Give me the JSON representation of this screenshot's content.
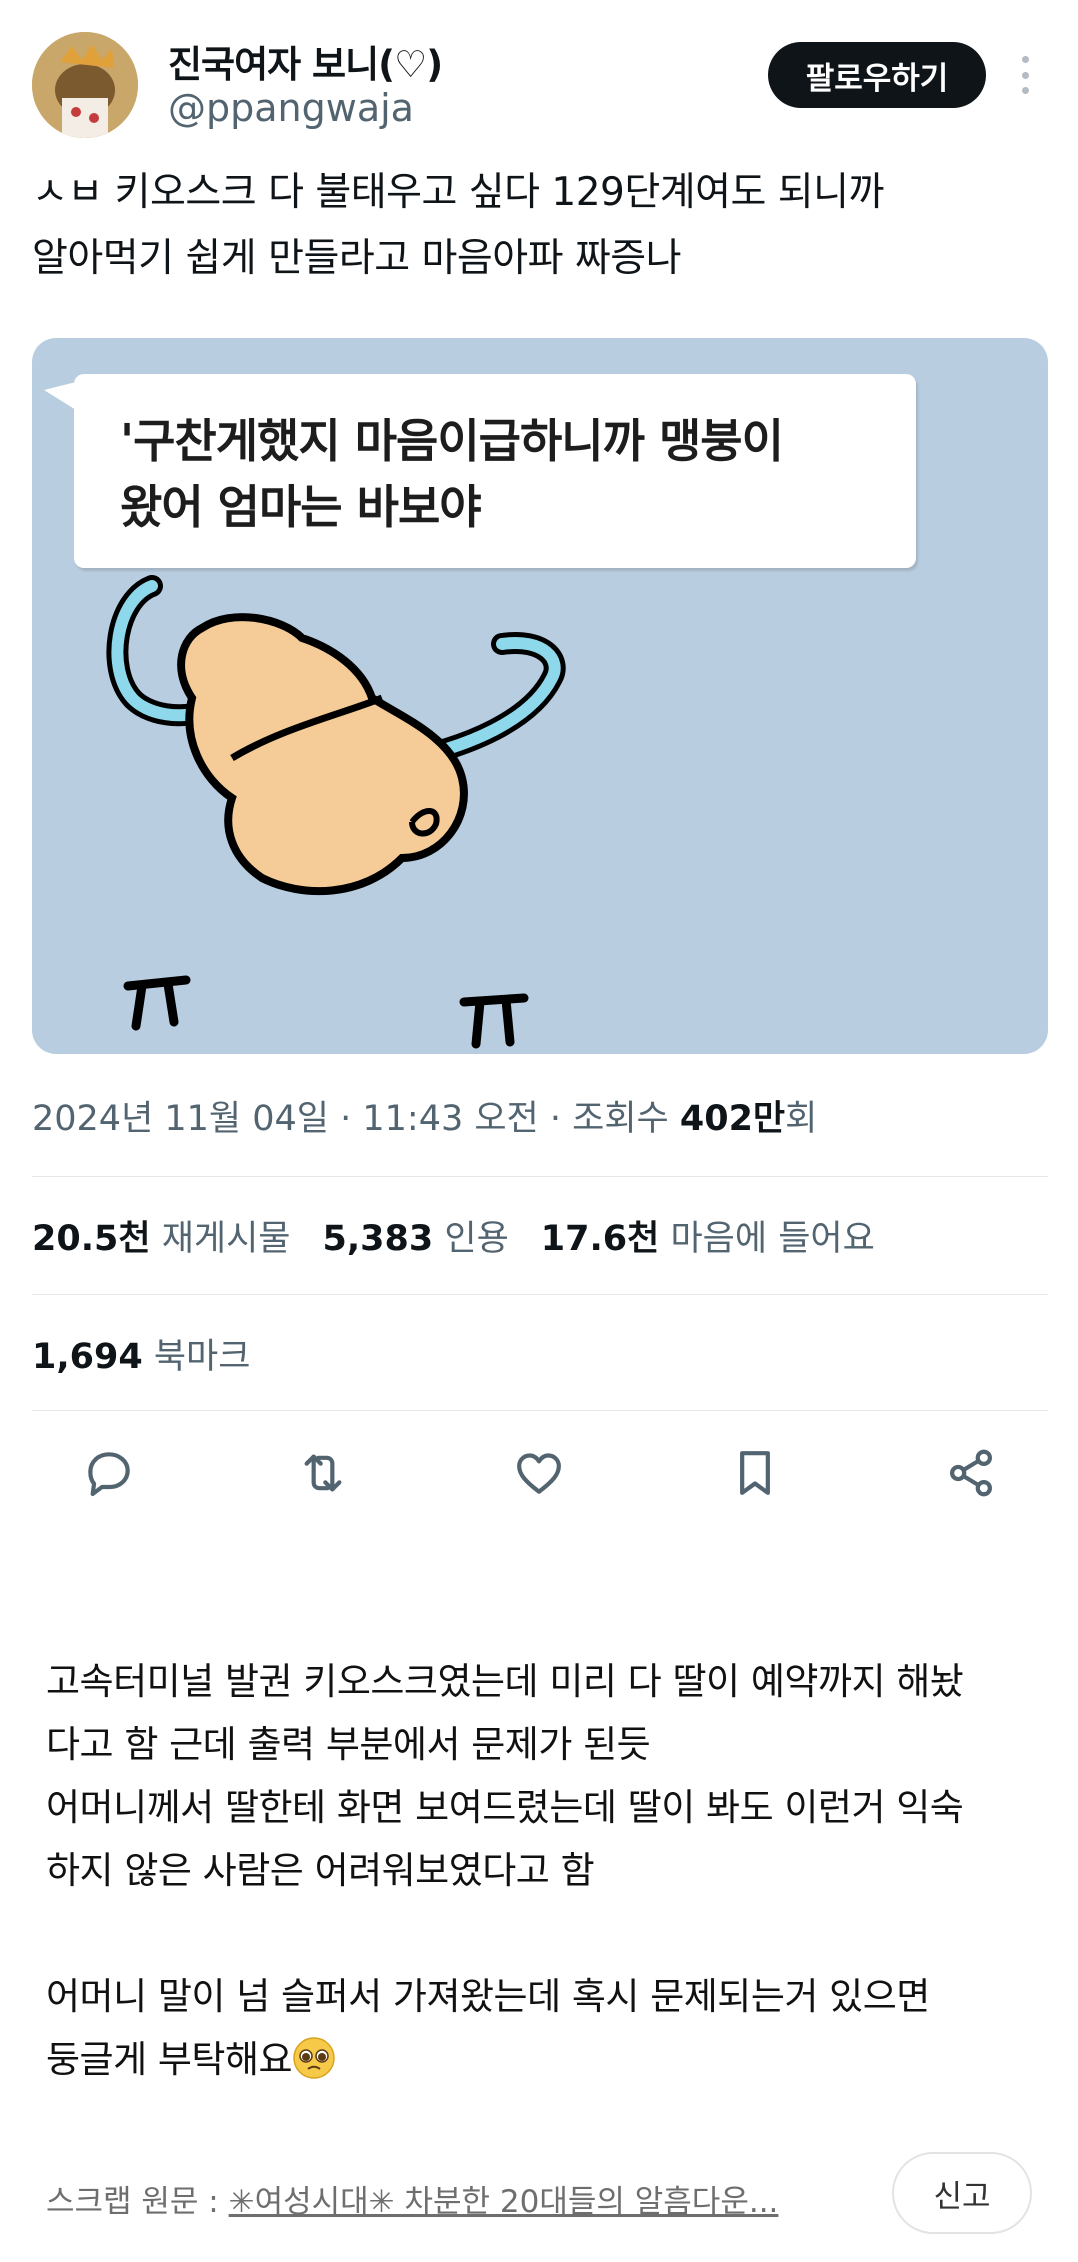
{
  "author": {
    "display_name": "진국여자 보니(♡)",
    "handle": "@ppangwaja",
    "follow_label": "팔로우하기"
  },
  "tweet": {
    "text": "ㅅㅂ 키오스크 다 불태우고 싶다 129단계여도 되니까\n알아먹기 쉽게 만들라고 마음아파 짜증나",
    "image_caption": "'구찬게했지 마음이급하니까 맹붕이\n왔어  엄마는 바보야"
  },
  "meta": {
    "date_time": "2024년 11월 04일 · 11:43 오전 · 조회수 ",
    "views_number": "402만",
    "views_suffix": "회"
  },
  "stats": {
    "retweets_num": "20.5천",
    "retweets_label": "재게시물",
    "quotes_num": "5,383",
    "quotes_label": "인용",
    "likes_num": "17.6천",
    "likes_label": "마음에 들어요",
    "bookmarks_num": "1,694",
    "bookmarks_label": "북마크"
  },
  "actions": {
    "icons": [
      "reply-icon",
      "retweet-icon",
      "like-icon",
      "bookmark-icon",
      "share-icon"
    ]
  },
  "post": {
    "body": "고속터미널 발권 키오스크였는데 미리 다 딸이 예약까지 해놨\n다고 함 근데 출력 부분에서 문제가 된듯\n어머니께서 딸한테 화면 보여드렸는데 딸이 봐도 이런거 익숙\n하지 않은 사람은 어려워보였다고 함\n\n어머니 말이 넘 슬퍼서 가져왔는데 혹시 문제되는거 있으면\n둥글게 부탁해요",
    "source_prefix": "스크랩 원문 : ",
    "source_link": "✳여성시대✳ 차분한 20대들의 알흠다운...",
    "report_label": "신고"
  },
  "colors": {
    "image_bg": "#b9cde0",
    "secondary_text": "#536471",
    "follow_bg": "#0f1419"
  }
}
